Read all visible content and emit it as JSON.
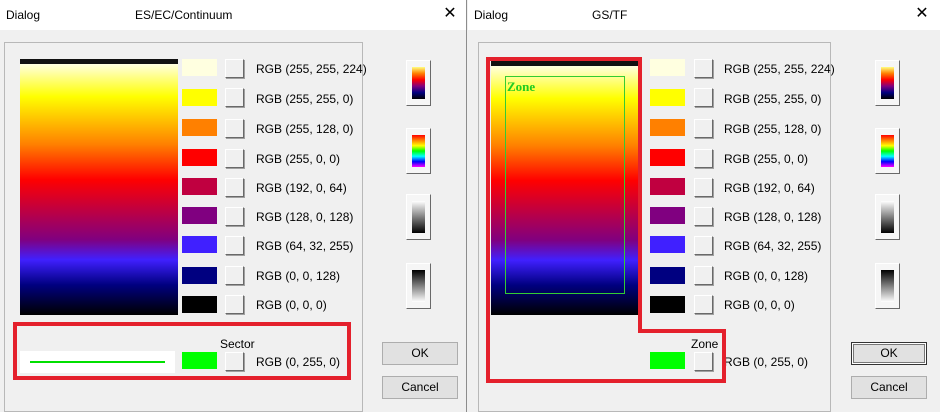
{
  "dialogs": [
    {
      "window_label": "Dialog",
      "title": "ES/EC/Continuum",
      "close": "✕",
      "colors": [
        {
          "hex": "#ffffe0",
          "label": "RGB (255, 255, 224)"
        },
        {
          "hex": "#ffff00",
          "label": "RGB (255, 255, 0)"
        },
        {
          "hex": "#ff8000",
          "label": "RGB (255, 128, 0)"
        },
        {
          "hex": "#ff0000",
          "label": "RGB (255, 0, 0)"
        },
        {
          "hex": "#c00040",
          "label": "RGB (192, 0, 64)"
        },
        {
          "hex": "#800080",
          "label": "RGB (128, 0, 128)"
        },
        {
          "hex": "#4020ff",
          "label": "RGB (64, 32, 255)"
        },
        {
          "hex": "#000080",
          "label": "RGB (0, 0, 128)"
        },
        {
          "hex": "#000000",
          "label": "RGB (0, 0, 0)"
        }
      ],
      "extra": {
        "caption": "Sector",
        "hex": "#00ff00",
        "label": "RGB (0, 255, 0)"
      },
      "ok": "OK",
      "cancel": "Cancel"
    },
    {
      "window_label": "Dialog",
      "title": "GS/TF",
      "close": "✕",
      "zone_overlay_label": "Zone",
      "colors": [
        {
          "hex": "#ffffe0",
          "label": "RGB (255, 255, 224)"
        },
        {
          "hex": "#ffff00",
          "label": "RGB (255, 255, 0)"
        },
        {
          "hex": "#ff8000",
          "label": "RGB (255, 128, 0)"
        },
        {
          "hex": "#ff0000",
          "label": "RGB (255, 0, 0)"
        },
        {
          "hex": "#c00040",
          "label": "RGB (192, 0, 64)"
        },
        {
          "hex": "#800080",
          "label": "RGB (128, 0, 128)"
        },
        {
          "hex": "#4020ff",
          "label": "RGB (64, 32, 255)"
        },
        {
          "hex": "#000080",
          "label": "RGB (0, 0, 128)"
        },
        {
          "hex": "#000000",
          "label": "RGB (0, 0, 0)"
        }
      ],
      "extra": {
        "caption": "Zone",
        "hex": "#00ff00",
        "label": "RGB (0, 255, 0)"
      },
      "ok": "OK",
      "cancel": "Cancel"
    }
  ],
  "highlight_color": "#e4202c",
  "presets": [
    "heat-palette",
    "rainbow-palette",
    "white-to-black-palette",
    "black-to-white-palette"
  ]
}
